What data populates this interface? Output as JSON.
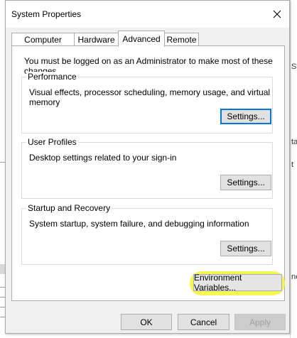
{
  "window": {
    "title": "System Properties"
  },
  "tabs": [
    {
      "label": "Computer Name"
    },
    {
      "label": "Hardware"
    },
    {
      "label": "Advanced"
    },
    {
      "label": "Remote"
    }
  ],
  "advanced": {
    "admin_note": "You must be logged on as an Administrator to make most of these changes.",
    "performance": {
      "label": "Performance",
      "description": "Visual effects, processor scheduling, memory usage, and virtual memory",
      "button": "Settings..."
    },
    "user_profiles": {
      "label": "User Profiles",
      "description": "Desktop settings related to your sign-in",
      "button": "Settings..."
    },
    "startup_recovery": {
      "label": "Startup and Recovery",
      "description": "System startup, system failure, and debugging information",
      "button": "Settings..."
    },
    "env_button": "Environment Variables..."
  },
  "footer": {
    "ok": "OK",
    "cancel": "Cancel",
    "apply": "Apply"
  },
  "background": {
    "right_fragments": [
      "Sy",
      "ta",
      "ne",
      "t"
    ]
  },
  "colors": {
    "focus_border": "#0078d7",
    "highlight": "#f4f44a"
  }
}
